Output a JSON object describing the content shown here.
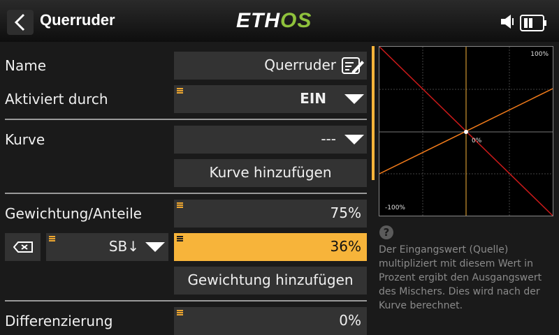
{
  "header": {
    "title": "Querruder",
    "logo_prefix": "ETH",
    "logo_suffix": "OS"
  },
  "rows": {
    "name": {
      "label": "Name",
      "value": "Querruder"
    },
    "activated_by": {
      "label": "Aktiviert durch",
      "value": "EIN"
    },
    "curve": {
      "label": "Kurve",
      "value": "---",
      "add_label": "Kurve hinzufügen"
    },
    "weight": {
      "label": "Gewichtung/Anteile",
      "value": "75%"
    },
    "weight_switch": {
      "source": "SB↓",
      "value": "36%",
      "add_label": "Gewichtung hinzufügen"
    },
    "differential": {
      "label": "Differenzierung",
      "value": "0%"
    }
  },
  "graph": {
    "top_label": "100%",
    "center_label": "0%",
    "bottom_label": "-100%"
  },
  "help": {
    "icon": "?",
    "text": "Der Eingangswert (Quelle) multipliziert mit diesem Wert in Prozent ergibt den Ausgangswert des Mischers. Dies wird nach der Kurve berechnet."
  },
  "colors": {
    "accent": "#f7b43a",
    "field": "#333333",
    "background": "#1a1a1a",
    "logo_green": "#8fc23c",
    "graph_line_orange": "#f07a1a",
    "graph_line_red": "#cc1a1a"
  }
}
